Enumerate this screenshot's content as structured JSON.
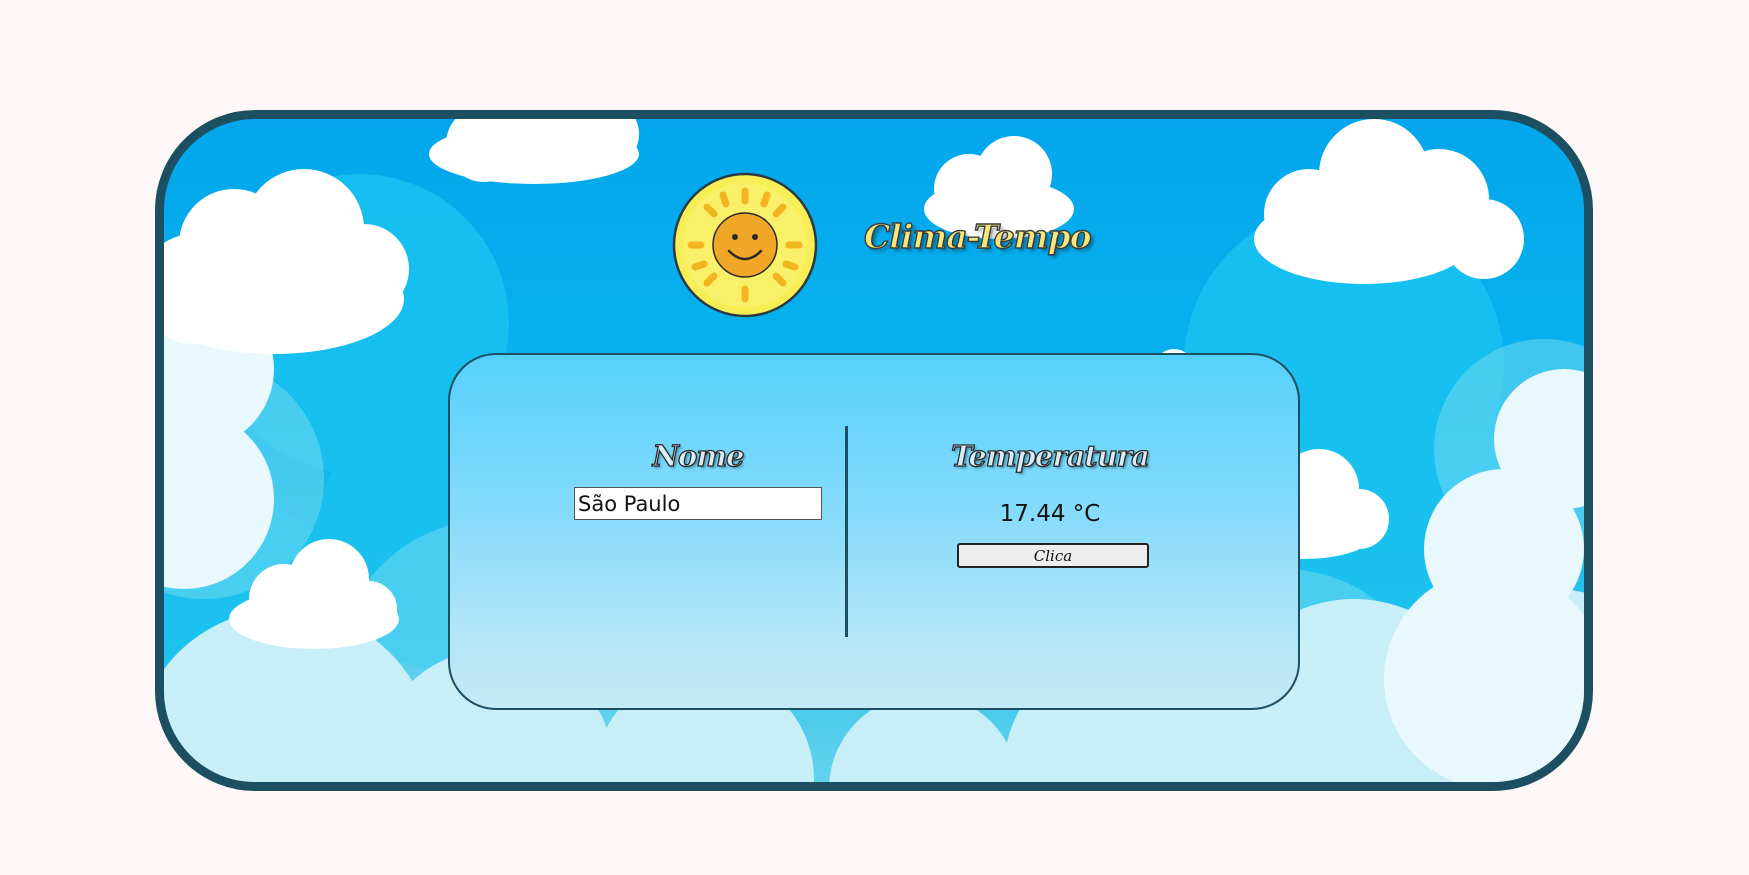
{
  "app": {
    "title": "Clima-Tempo"
  },
  "form": {
    "name_label": "Nome",
    "name_value": "São Paulo",
    "temperature_label": "Temperatura",
    "temperature_value": "17.44 °C",
    "button_label": "Clica"
  },
  "icons": {
    "logo": "smiling-sun-icon"
  },
  "colors": {
    "page_background": "#fdf8f7",
    "frame_border": "#1d4f63",
    "sky_blue": "#03a6ec",
    "card_top": "#55d1fd",
    "card_bottom": "#c2eaf7",
    "sun_yellow": "#f5ec3a",
    "sun_face": "#f0a626",
    "title_fill": "#f7e77a"
  }
}
